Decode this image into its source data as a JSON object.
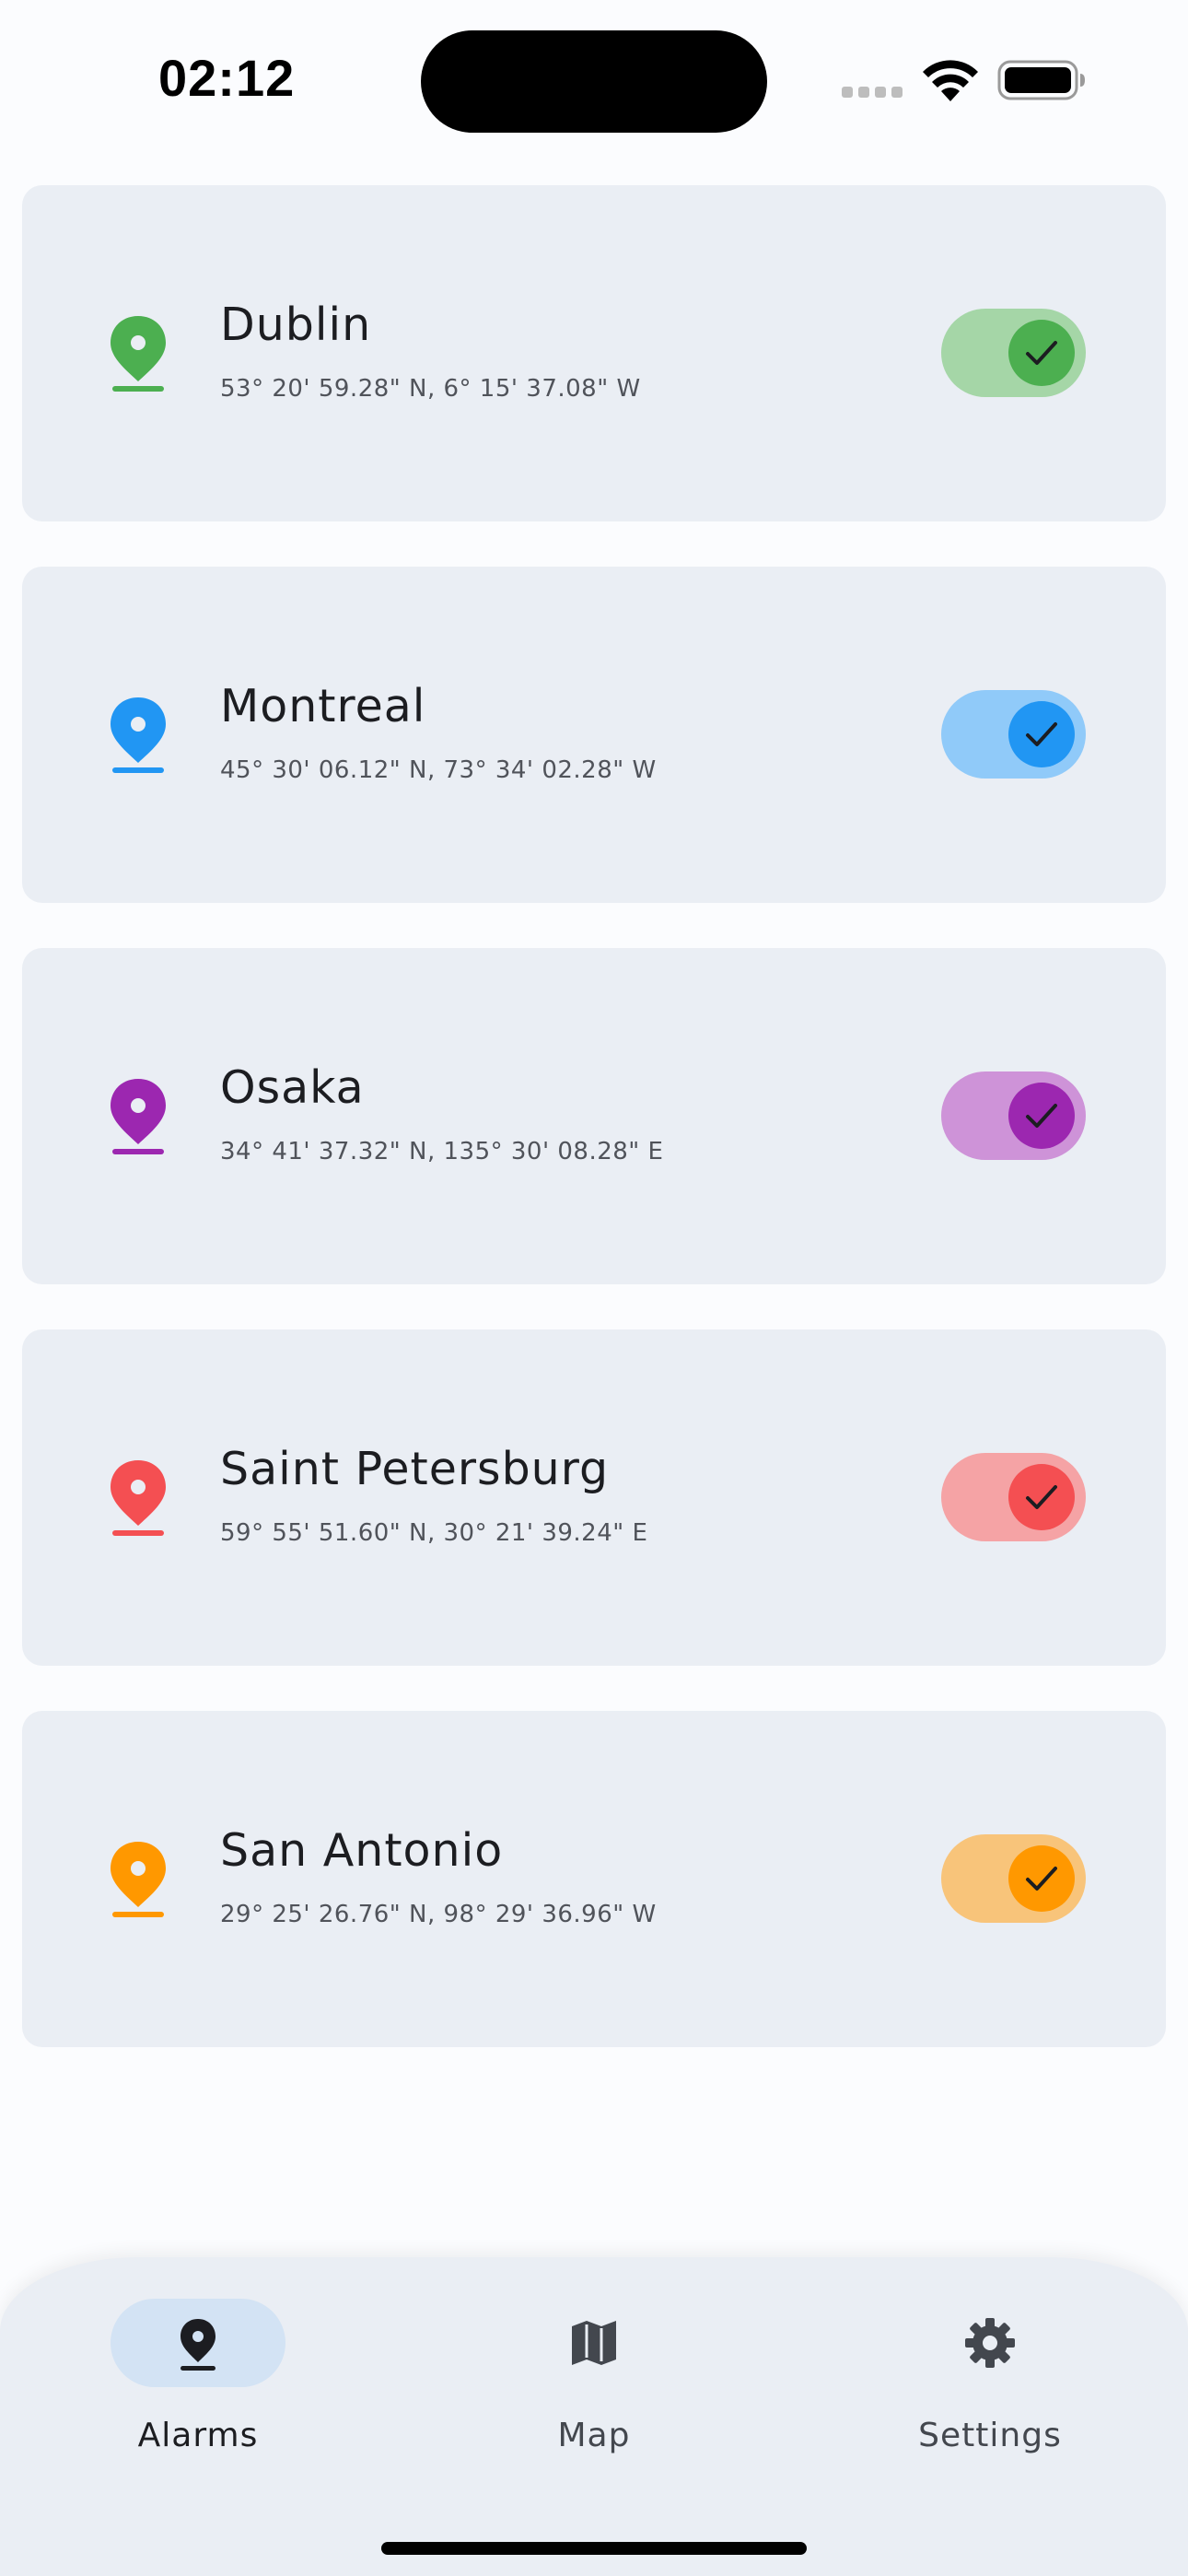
{
  "status_bar": {
    "time": "02:12"
  },
  "alarms": [
    {
      "name": "Dublin",
      "coords": "53° 20' 59.28\" N, 6° 15' 37.08\" W",
      "enabled": true,
      "color": "#4caf50",
      "track_color": "#a5d6a7"
    },
    {
      "name": "Montreal",
      "coords": "45° 30' 06.12\" N, 73° 34' 02.28\" W",
      "enabled": true,
      "color": "#2196f3",
      "track_color": "#90caf9"
    },
    {
      "name": "Osaka",
      "coords": "34° 41' 37.32\" N, 135° 30' 08.28\" E",
      "enabled": true,
      "color": "#9c27b0",
      "track_color": "#ce93d8"
    },
    {
      "name": "Saint Petersburg",
      "coords": "59° 55' 51.60\" N, 30° 21' 39.24\" E",
      "enabled": true,
      "color": "#f44f52",
      "track_color": "#f5a3a5"
    },
    {
      "name": "San Antonio",
      "coords": "29° 25' 26.76\" N, 98° 29' 36.96\" W",
      "enabled": true,
      "color": "#ff9800",
      "track_color": "#f8c47a"
    }
  ],
  "bottom_nav": {
    "items": [
      {
        "label": "Alarms",
        "icon": "location-pin-icon",
        "active": true
      },
      {
        "label": "Map",
        "icon": "map-icon",
        "active": false
      },
      {
        "label": "Settings",
        "icon": "gear-icon",
        "active": false
      }
    ]
  },
  "colors": {
    "background": "#fbfcfe",
    "card": "#eaeef4",
    "nav_active_pill": "#d3e3f4",
    "check": "#1c1d21"
  }
}
